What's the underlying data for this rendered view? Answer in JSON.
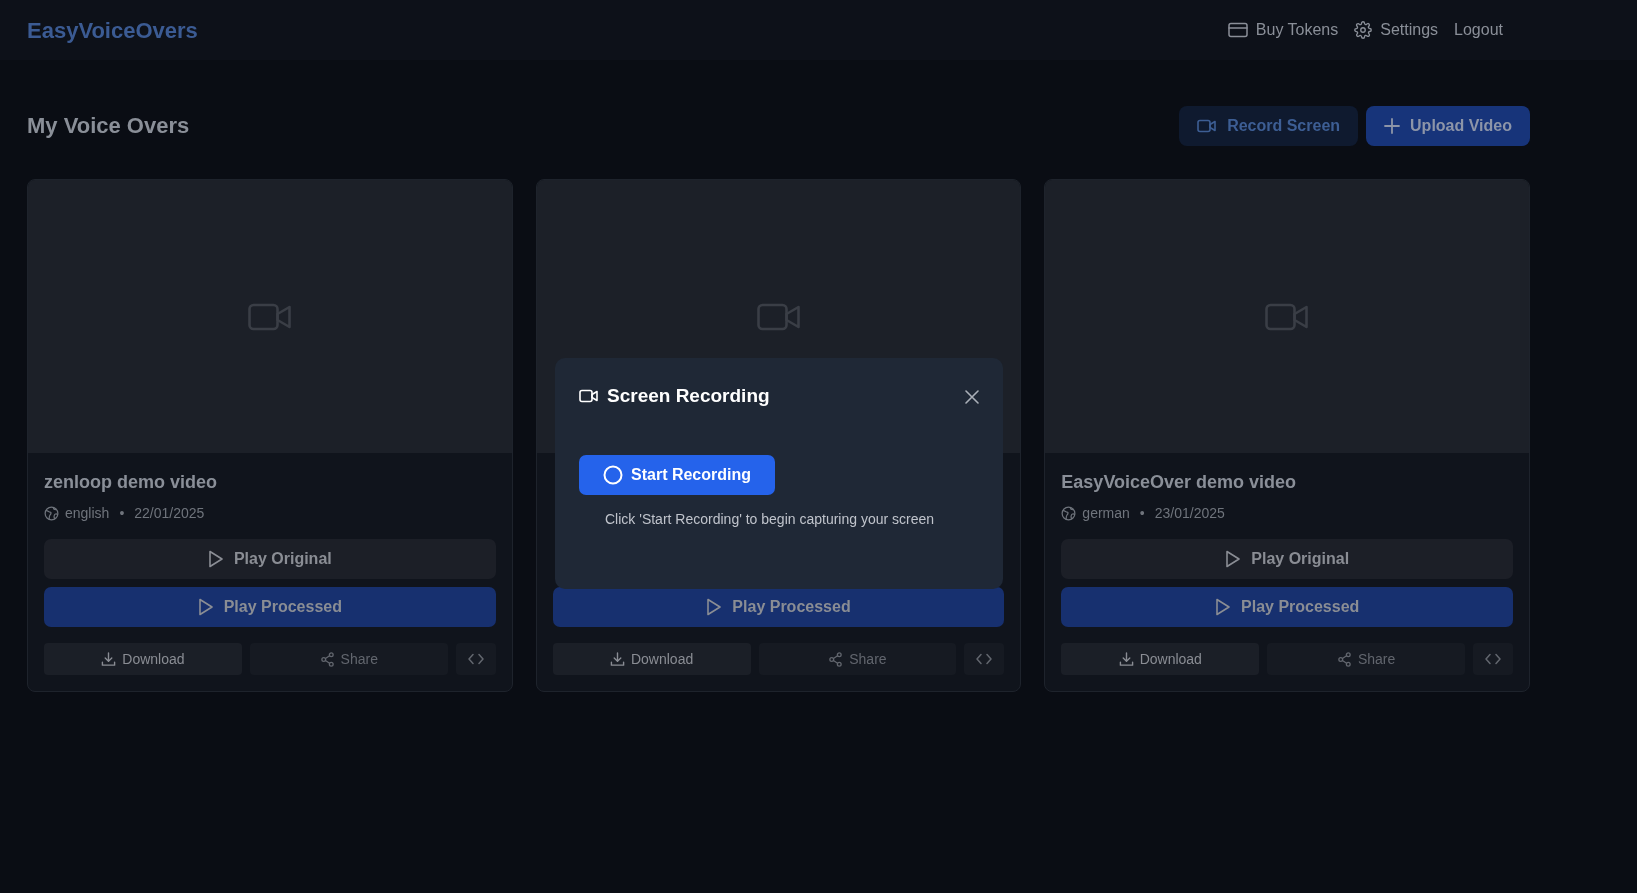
{
  "navbar": {
    "brand": "EasyVoiceOvers",
    "links": [
      {
        "label": "Buy Tokens"
      },
      {
        "label": "Settings"
      },
      {
        "label": "Logout"
      }
    ]
  },
  "page": {
    "title": "My Voice Overs",
    "actions": [
      {
        "label": "Record Screen",
        "kind": "secondary"
      },
      {
        "label": "Upload Video",
        "kind": "primary"
      }
    ]
  },
  "cards": [
    {
      "title": "zenloop demo video",
      "language": "english",
      "separator": "•",
      "date": "22/01/2025",
      "play_original": "Play Original",
      "play_processed": "Play Processed",
      "download": "Download",
      "share": "Share"
    },
    {
      "play_processed": "Play Processed",
      "download": "Download",
      "share": "Share"
    },
    {
      "title": "EasyVoiceOver demo video",
      "language": "german",
      "separator": "•",
      "date": "23/01/2025",
      "play_original": "Play Original",
      "play_processed": "Play Processed",
      "download": "Download",
      "share": "Share"
    }
  ],
  "modal": {
    "title": "Screen Recording",
    "start_button": "Start Recording",
    "hint": "Click 'Start Recording' to begin capturing your screen"
  }
}
